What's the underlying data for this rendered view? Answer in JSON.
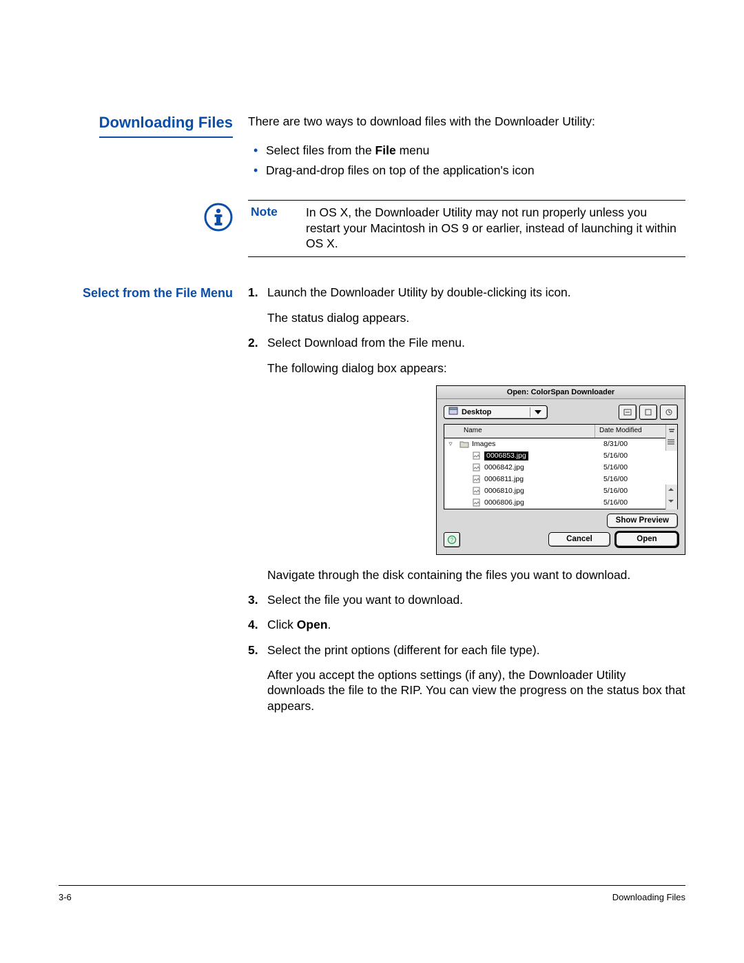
{
  "heading": "Downloading Files",
  "intro": "There are two ways to download files with the Downloader Utility:",
  "bullet1_pre": "Select files from the ",
  "bullet1_bold": "File",
  "bullet1_post": " menu",
  "bullet2": "Drag-and-drop files on top of the application's icon",
  "note_label": "Note",
  "note_text": "In OS X, the Downloader Utility may not run properly unless you restart your Macintosh in OS 9 or earlier, instead of launching it within OS X.",
  "subheading": "Select from the File Menu",
  "steps": {
    "s1_num": "1.",
    "s1_a": "Launch the Downloader Utility by double-clicking its icon.",
    "s1_b": "The status dialog appears.",
    "s2_num": "2.",
    "s2_a": "Select Download from the File menu.",
    "s2_b": "The following dialog box appears:",
    "s2_c": "Navigate through the disk containing the files you want to download.",
    "s3_num": "3.",
    "s3_a": "Select the file you want to download.",
    "s4_num": "4.",
    "s4_pre": "Click ",
    "s4_bold": "Open",
    "s4_post": ".",
    "s5_num": "5.",
    "s5_a": "Select the print options (different for each file type).",
    "s5_b": "After you accept the options settings (if any), the Downloader Utility downloads the file to the RIP. You can view the progress on the status box that appears."
  },
  "dialog": {
    "title": "Open: ColorSpan Downloader",
    "location": "Desktop",
    "col_name": "Name",
    "col_date": "Date Modified",
    "rows": [
      {
        "name": "Images",
        "date": "8/31/00",
        "folder": true,
        "indent": 0,
        "toggle": "▿",
        "selected": false
      },
      {
        "name": "0006853.jpg",
        "date": "5/16/00",
        "folder": false,
        "indent": 1,
        "toggle": "",
        "selected": true
      },
      {
        "name": "0006842.jpg",
        "date": "5/16/00",
        "folder": false,
        "indent": 1,
        "toggle": "",
        "selected": false
      },
      {
        "name": "0006811.jpg",
        "date": "5/16/00",
        "folder": false,
        "indent": 1,
        "toggle": "",
        "selected": false
      },
      {
        "name": "0006810.jpg",
        "date": "5/16/00",
        "folder": false,
        "indent": 1,
        "toggle": "",
        "selected": false
      },
      {
        "name": "0006806.jpg",
        "date": "5/16/00",
        "folder": false,
        "indent": 1,
        "toggle": "",
        "selected": false
      }
    ],
    "show_preview": "Show Preview",
    "cancel": "Cancel",
    "open": "Open"
  },
  "footer_left": "3-6",
  "footer_right": "Downloading Files"
}
